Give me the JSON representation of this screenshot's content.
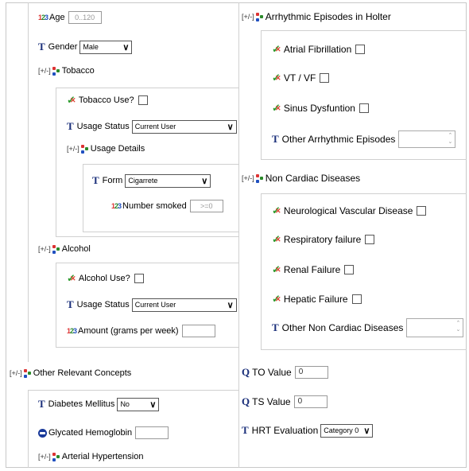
{
  "left": {
    "age": {
      "label": "Age",
      "placeholder": "0..120"
    },
    "gender": {
      "label": "Gender",
      "value": "Male"
    },
    "tobacco": {
      "toggle": "[+/-]",
      "label": "Tobacco",
      "use": {
        "label": "Tobacco Use?"
      },
      "usage_status": {
        "label": "Usage Status",
        "value": "Current User"
      },
      "usage_details": {
        "toggle": "[+/-]",
        "label": "Usage Details",
        "form": {
          "label": "Form",
          "value": "Cigarrete"
        },
        "number_smoked": {
          "label": "Number smoked",
          "placeholder": ">=0"
        }
      }
    },
    "alcohol": {
      "toggle": "[+/-]",
      "label": "Alcohol",
      "use": {
        "label": "Alcohol Use?"
      },
      "usage_status": {
        "label": "Usage Status",
        "value": "Current User"
      },
      "amount": {
        "label": "Amount (grams per week)",
        "value": ""
      }
    },
    "other": {
      "toggle": "[+/-]",
      "label": "Other Relevant Concepts",
      "diabetes": {
        "label": "Diabetes Mellitus",
        "value": "No"
      },
      "hba1c": {
        "label": "Glycated Hemoglobin",
        "value": ""
      },
      "hypertension": {
        "toggle": "[+/-]",
        "label": "Arterial Hypertension"
      }
    }
  },
  "right": {
    "holter": {
      "toggle": "[+/-]",
      "label": "Arrhythmic Episodes in Holter",
      "items": [
        {
          "label": "Atrial Fibrillation"
        },
        {
          "label": "VT / VF"
        },
        {
          "label": "Sinus Dysfuntion"
        }
      ],
      "other": {
        "label": "Other Arrhythmic Episodes",
        "value": ""
      }
    },
    "noncardiac": {
      "toggle": "[+/-]",
      "label": "Non Cardiac Diseases",
      "items": [
        {
          "label": "Neurological Vascular Disease"
        },
        {
          "label": "Respiratory failure"
        },
        {
          "label": "Renal Failure"
        },
        {
          "label": "Hepatic Failure"
        }
      ],
      "other": {
        "label": "Other Non Cardiac Diseases",
        "value": ""
      }
    },
    "to_value": {
      "label": "TO Value",
      "value": "0"
    },
    "ts_value": {
      "label": "TS Value",
      "value": "0"
    },
    "hrt": {
      "label": "HRT Evaluation",
      "value": "Category 0"
    }
  }
}
